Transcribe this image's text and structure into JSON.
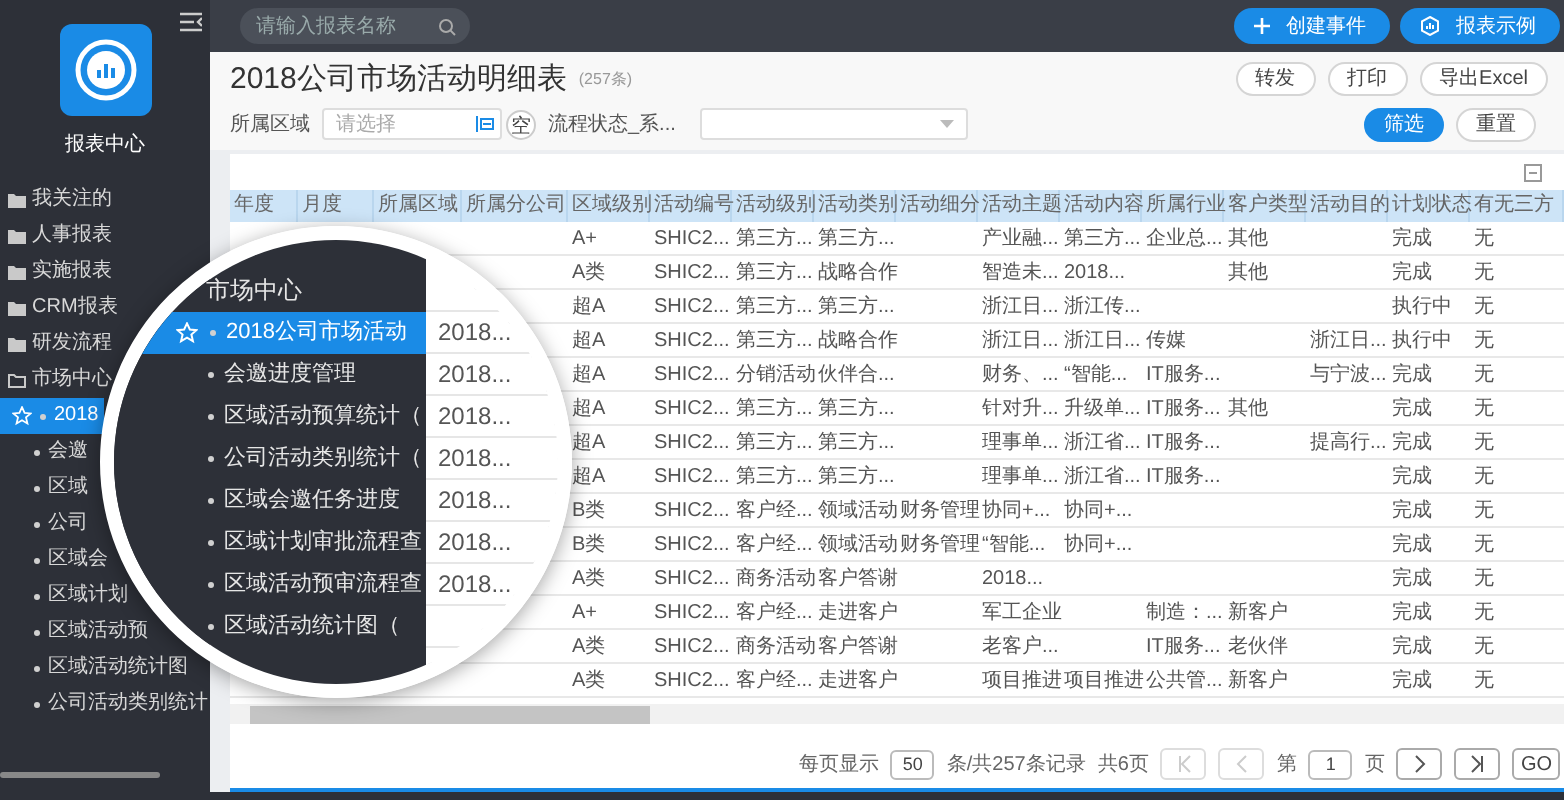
{
  "topbar": {
    "search": {
      "placeholder": "请输入报表名称"
    },
    "buttons": [
      {
        "label": "创建事件",
        "kind": "create"
      },
      {
        "label": "报表示例",
        "kind": "examples"
      }
    ]
  },
  "sidebar": {
    "title": "报表中心",
    "items": [
      {
        "label": "我关注的",
        "expanded": false
      },
      {
        "label": "人事报表",
        "expanded": false
      },
      {
        "label": "实施报表",
        "expanded": false
      },
      {
        "label": "CRM报表",
        "expanded": false
      },
      {
        "label": "研发流程",
        "expanded": false
      },
      {
        "label": "市场中心",
        "expanded": true,
        "children": [
          {
            "label": "2018",
            "selected": true
          },
          {
            "label": "会邀",
            "selected": false
          },
          {
            "label": "区域",
            "selected": false
          },
          {
            "label": "公司",
            "selected": false
          },
          {
            "label": "区域会",
            "selected": false
          },
          {
            "label": "区域计划",
            "selected": false
          },
          {
            "label": "区域活动预",
            "selected": false
          },
          {
            "label": "区域活动统计图",
            "selected": false
          },
          {
            "label": "公司活动类别统计",
            "selected": false
          }
        ]
      }
    ]
  },
  "report": {
    "title": "2018公司市场活动明细表",
    "count": "(257条)",
    "actions": [
      "转发",
      "打印",
      "导出Excel"
    ],
    "filters": [
      {
        "label": "所属区域",
        "kind": "picker",
        "placeholder": "请选择",
        "clear": "空"
      },
      {
        "label": "流程状态_系...",
        "kind": "select"
      }
    ],
    "filter_buttons": [
      {
        "label": "筛选",
        "kind": "primary"
      },
      {
        "label": "重置",
        "kind": "default"
      }
    ]
  },
  "table": {
    "columns": [
      "年度",
      "月度",
      "所属区域",
      "所属分公司",
      "区域级别",
      "活动编号",
      "活动级别",
      "活动类别",
      "活动细分",
      "活动主题",
      "活动内容",
      "所属行业",
      "客户类型",
      "活动目的",
      "计划状态",
      "有无三方"
    ],
    "rows": [
      [
        null,
        null,
        null,
        null,
        "A+",
        "SHIC2...",
        "第三方...",
        "第三方...",
        null,
        "产业融...",
        "第三方...",
        "企业总...",
        "其他",
        null,
        "完成",
        "无"
      ],
      [
        null,
        null,
        null,
        null,
        "A类",
        "SHIC2...",
        "第三方...",
        "战略合作",
        null,
        "智造未...",
        "2018...",
        null,
        "其他",
        null,
        "完成",
        "无"
      ],
      [
        null,
        null,
        null,
        null,
        "超A",
        "SHIC2...",
        "第三方...",
        "第三方...",
        null,
        "浙江日...",
        "浙江传...",
        null,
        null,
        null,
        "执行中",
        "无"
      ],
      [
        null,
        null,
        null,
        null,
        "超A",
        "SHIC2...",
        "第三方...",
        "战略合作",
        null,
        "浙江日...",
        "浙江日...",
        "传媒",
        null,
        "浙江日...",
        "执行中",
        "无"
      ],
      [
        null,
        null,
        null,
        null,
        "超A",
        "SHIC2...",
        "分销活动",
        "伙伴合...",
        null,
        "财务、...",
        "“智能...",
        "IT服务...",
        null,
        "与宁波...",
        "完成",
        "无"
      ],
      [
        null,
        null,
        null,
        null,
        "超A",
        "SHIC2...",
        "第三方...",
        "第三方...",
        null,
        "针对升...",
        "升级单...",
        "IT服务...",
        "其他",
        null,
        "完成",
        "无"
      ],
      [
        null,
        null,
        null,
        null,
        "超A",
        "SHIC2...",
        "第三方...",
        "第三方...",
        null,
        "理事单...",
        "浙江省...",
        "IT服务...",
        null,
        "提高行...",
        "完成",
        "无"
      ],
      [
        null,
        null,
        null,
        null,
        "超A",
        "SHIC2...",
        "第三方...",
        "第三方...",
        null,
        "理事单...",
        "浙江省...",
        "IT服务...",
        null,
        null,
        "完成",
        "无"
      ],
      [
        null,
        null,
        null,
        null,
        "B类",
        "SHIC2...",
        "客户经...",
        "领域活动",
        "财务管理",
        "协同+...",
        "协同+...",
        null,
        null,
        null,
        "完成",
        "无"
      ],
      [
        null,
        null,
        null,
        null,
        "B类",
        "SHIC2...",
        "客户经...",
        "领域活动",
        "财务管理",
        "“智能...",
        "协同+...",
        null,
        null,
        null,
        "完成",
        "无"
      ],
      [
        null,
        null,
        null,
        null,
        "A类",
        "SHIC2...",
        "商务活动",
        "客户答谢",
        null,
        "2018...",
        null,
        null,
        null,
        null,
        "完成",
        "无"
      ],
      [
        null,
        null,
        null,
        null,
        "A+",
        "SHIC2...",
        "客户经...",
        "走进客户",
        null,
        "军工企业",
        null,
        "制造：...",
        "新客户",
        null,
        "完成",
        "无"
      ],
      [
        null,
        null,
        null,
        null,
        "A类",
        "SHIC2...",
        "商务活动",
        "客户答谢",
        null,
        "老客户...",
        null,
        "IT服务...",
        "老伙伴",
        null,
        "完成",
        "无"
      ],
      [
        null,
        null,
        null,
        null,
        "A类",
        "SHIC2...",
        "客户经...",
        "走进客户",
        null,
        "项目推进",
        "项目推进",
        "公共管...",
        "新客户",
        null,
        "完成",
        "无"
      ]
    ]
  },
  "pagination": {
    "page_size_label": "每页显示",
    "page_size": "50",
    "summary": "条/共257条记录",
    "pages": "共6页",
    "page_prefix": "第",
    "page": "1",
    "page_suffix": "页",
    "go": "GO",
    "nav": [
      {
        "kind": "first",
        "disabled": true
      },
      {
        "kind": "prev",
        "disabled": true
      },
      {
        "kind": "next",
        "disabled": false
      },
      {
        "kind": "last",
        "disabled": false
      }
    ]
  },
  "magnifier": {
    "items": [
      {
        "label": "市场中心",
        "kind": "folder",
        "selected": false
      },
      {
        "label": "2018公司市场活动",
        "kind": "report",
        "selected": true
      },
      {
        "label": "会邀进度管理",
        "kind": "report",
        "selected": false
      },
      {
        "label": "区域活动预算统计（",
        "kind": "report",
        "selected": false
      },
      {
        "label": "公司活动类别统计（",
        "kind": "report",
        "selected": false
      },
      {
        "label": "区域会邀任务进度",
        "kind": "report",
        "selected": false
      },
      {
        "label": "区域计划审批流程查",
        "kind": "report",
        "selected": false
      },
      {
        "label": "区域活动预审流程查",
        "kind": "report",
        "selected": false
      },
      {
        "label": "区域活动统计图（",
        "kind": "report",
        "selected": false
      }
    ],
    "cells": [
      "2018...",
      "2018...",
      "2018...",
      "2018...",
      "2018...",
      "2018...",
      "2018..."
    ]
  }
}
